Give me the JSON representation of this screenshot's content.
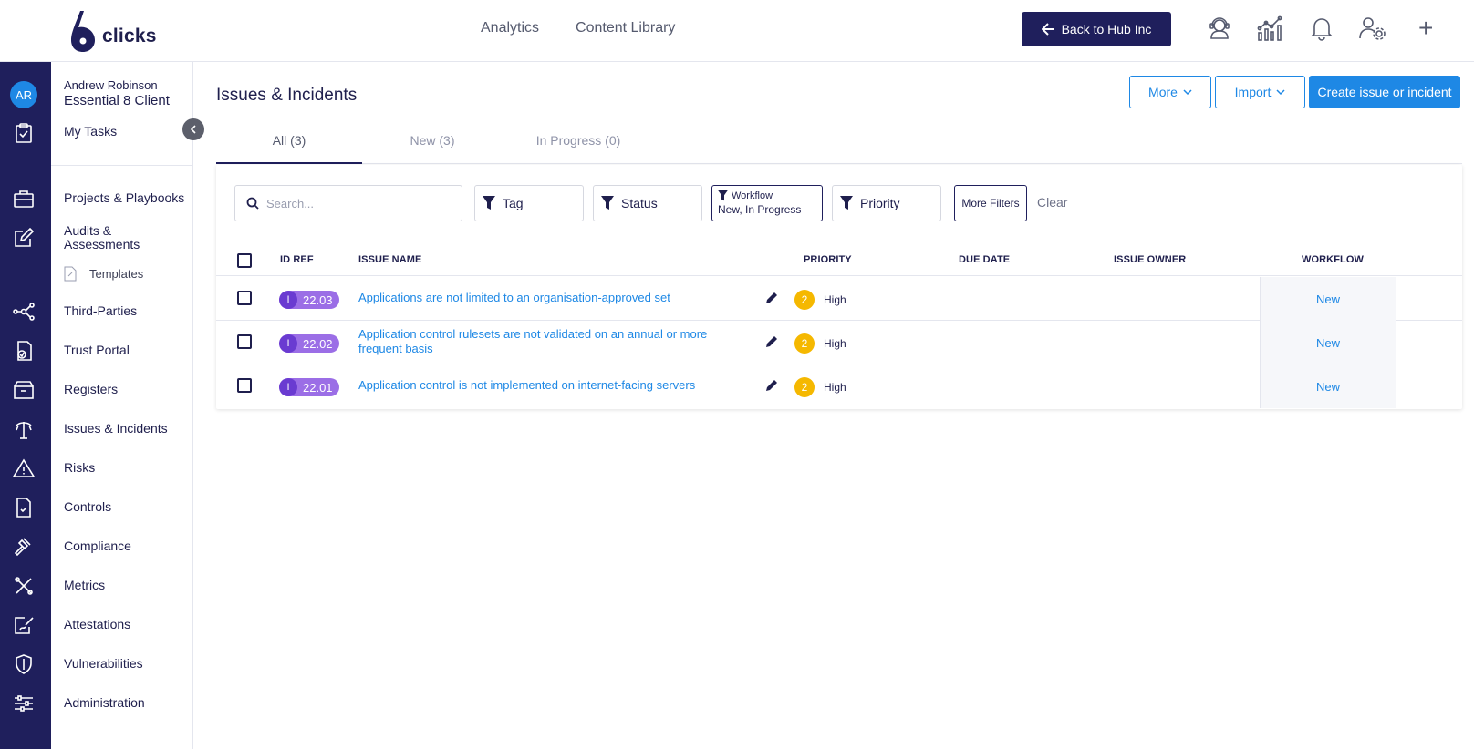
{
  "header": {
    "logo_text": "clicks",
    "nav": [
      "Analytics",
      "Content Library"
    ],
    "back_button": "Back to Hub Inc",
    "icons": [
      "support-icon",
      "analytics-chart-icon",
      "bell-icon",
      "user-settings-icon",
      "plus-icon"
    ]
  },
  "rail": {
    "avatar_initials": "AR"
  },
  "sidebar": {
    "user_name": "Andrew Robinson",
    "client_name": "Essential 8 Client",
    "my_tasks": "My Tasks",
    "items": [
      {
        "label": "Projects & Playbooks"
      },
      {
        "label": "Audits & Assessments"
      },
      {
        "label": "Templates"
      },
      {
        "label": "Third-Parties"
      },
      {
        "label": "Trust Portal"
      },
      {
        "label": "Registers"
      },
      {
        "label": "Issues & Incidents"
      },
      {
        "label": "Risks"
      },
      {
        "label": "Controls"
      },
      {
        "label": "Compliance"
      },
      {
        "label": "Metrics"
      },
      {
        "label": "Attestations"
      },
      {
        "label": "Vulnerabilities"
      },
      {
        "label": "Administration"
      }
    ]
  },
  "main": {
    "title": "Issues & Incidents",
    "more_button": "More",
    "import_button": "Import",
    "create_button": "Create issue or incident",
    "tabs": [
      {
        "label": "All (3)"
      },
      {
        "label": "New (3)"
      },
      {
        "label": "In Progress (0)"
      }
    ],
    "filters": {
      "search_placeholder": "Search...",
      "tag": "Tag",
      "status": "Status",
      "workflow_label": "Workflow",
      "workflow_value": "New, In Progress",
      "priority": "Priority",
      "more_filters": "More Filters",
      "clear": "Clear"
    },
    "table": {
      "columns": [
        "ID REF",
        "ISSUE NAME",
        "PRIORITY",
        "DUE DATE",
        "ISSUE OWNER",
        "WORKFLOW"
      ],
      "rows": [
        {
          "badge": "I",
          "id": "22.03",
          "name": "Applications are not limited to an organisation-approved set",
          "priority_num": "2",
          "priority": "High",
          "workflow": "New"
        },
        {
          "badge": "I",
          "id": "22.02",
          "name": "Application control rulesets are not validated on an annual or more frequent basis",
          "priority_num": "2",
          "priority": "High",
          "workflow": "New"
        },
        {
          "badge": "I",
          "id": "22.01",
          "name": "Application control is not implemented on internet-facing servers",
          "priority_num": "2",
          "priority": "High",
          "workflow": "New"
        }
      ]
    }
  },
  "colors": {
    "navy": "#1f1f5c",
    "accent": "#1e88e5",
    "badge_purple": "#9b6ee6",
    "priority_high": "#f5b800"
  }
}
